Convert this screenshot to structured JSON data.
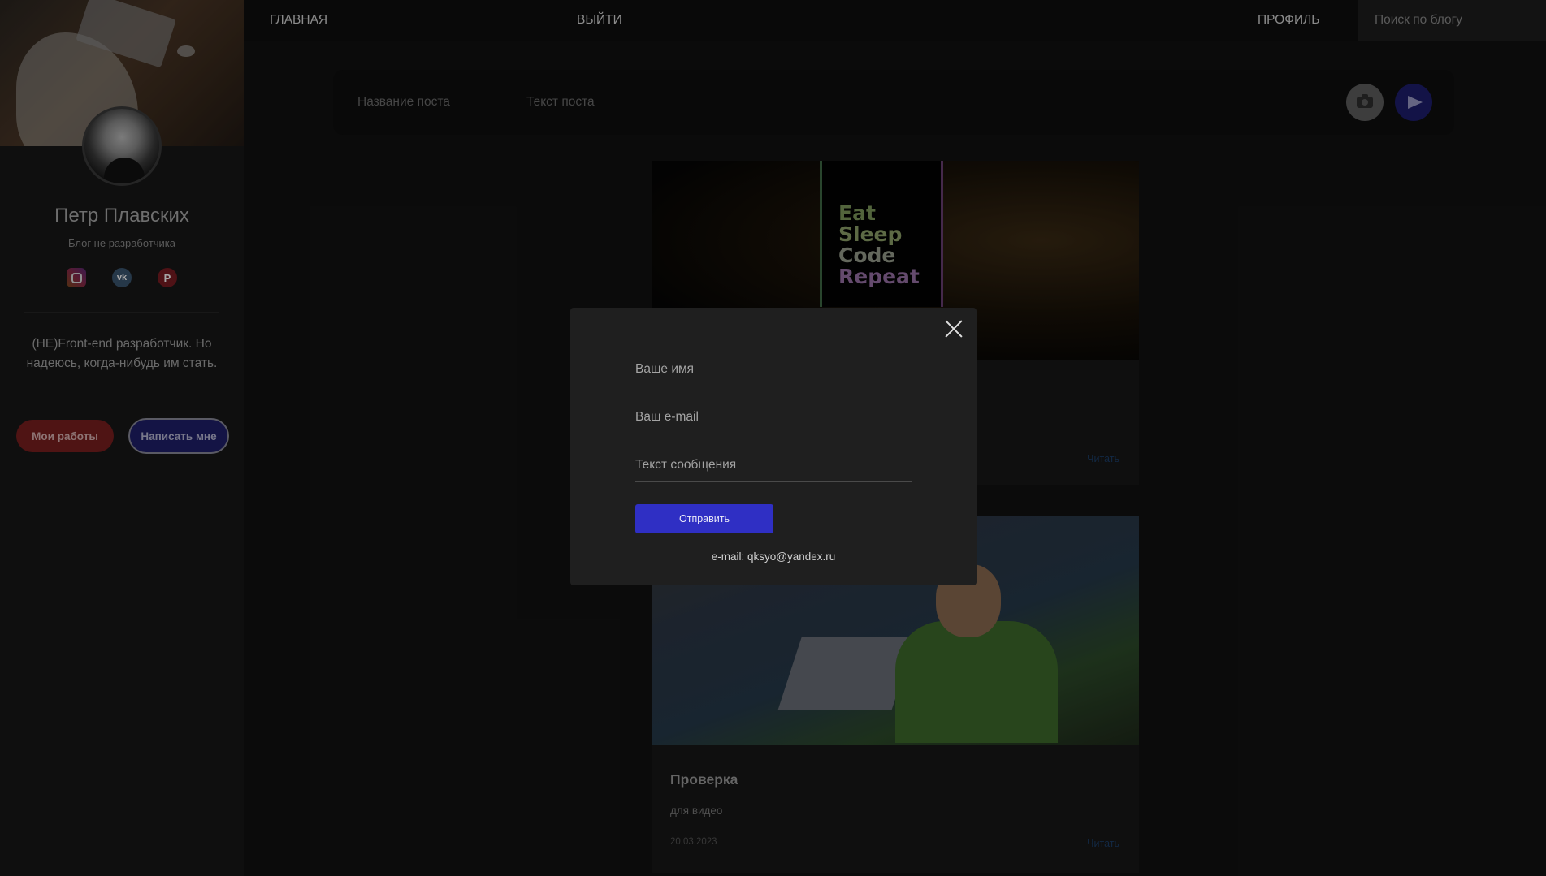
{
  "nav": {
    "home": "ГЛАВНАЯ",
    "logout": "ВЫЙТИ",
    "profile": "ПРОФИЛЬ",
    "search_placeholder": "Поиск по блогу"
  },
  "sidebar": {
    "name": "Петр Плавских",
    "tagline": "Блог не разработчика",
    "socials": [
      {
        "icon": "instagram-icon"
      },
      {
        "icon": "vk-icon",
        "glyph": "vk"
      },
      {
        "icon": "pinterest-icon",
        "glyph": "P"
      }
    ],
    "bio": "(НЕ)Front-end разработчик. Но надеюсь, когда-нибудь им стать.",
    "works_button": "Мои работы",
    "write_button": "Написать мне"
  },
  "post_form": {
    "title_placeholder": "Название поста",
    "text_placeholder": "Текст поста"
  },
  "posts": [
    {
      "image_text": [
        "Eat",
        "Sleep",
        "Code",
        "Repeat"
      ],
      "read_label": "Читать"
    },
    {
      "title": "Проверка",
      "description": "для видео",
      "date": "20.03.2023",
      "read_label": "Читать"
    }
  ],
  "modal": {
    "name_placeholder": "Ваше имя",
    "email_placeholder": "Ваш e-mail",
    "message_placeholder": "Текст сообщения",
    "submit_label": "Отправить",
    "contact": "e-mail: qksyo@yandex.ru"
  },
  "colors": {
    "accent_blue": "#2f2fc4",
    "works_red": "#7a1f1f",
    "write_navy": "#1f1f6a"
  }
}
